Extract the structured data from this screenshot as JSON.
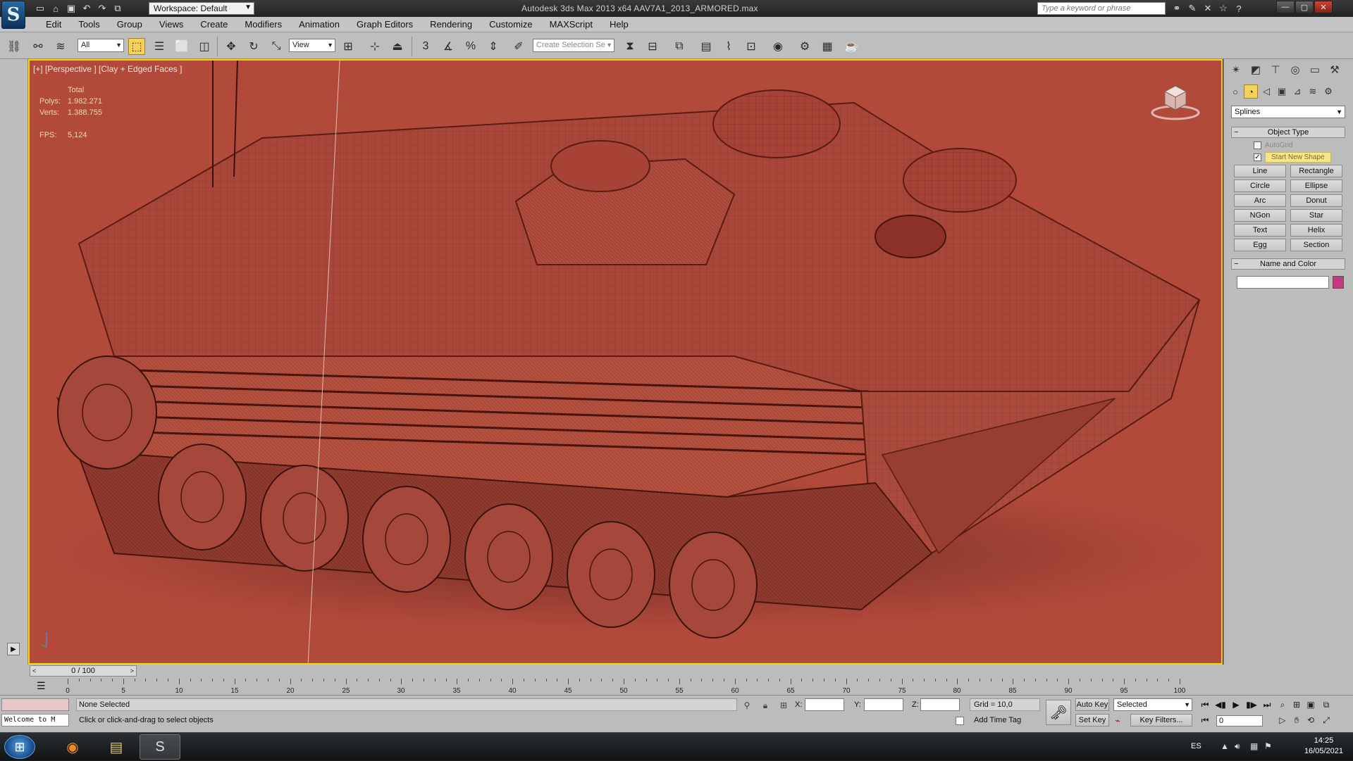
{
  "titlebar": {
    "workspace": "Workspace: Default",
    "window_title": "Autodesk 3ds Max  2013 x64    AAV7A1_2013_ARMORED.max",
    "search_placeholder": "Type a keyword or phrase"
  },
  "menu": [
    "Edit",
    "Tools",
    "Group",
    "Views",
    "Create",
    "Modifiers",
    "Animation",
    "Graph Editors",
    "Rendering",
    "Customize",
    "MAXScript",
    "Help"
  ],
  "toolbar": {
    "filter": "All",
    "ref_coord": "View",
    "selection_set_placeholder": "Create Selection Se"
  },
  "viewport": {
    "label": "[+] [Perspective ] [Clay + Edged Faces ]",
    "stats": {
      "header": "Total",
      "polys_label": "Polys:",
      "polys": "1.982.271",
      "verts_label": "Verts:",
      "verts": "1.388.755",
      "fps_label": "FPS:",
      "fps": "5,124"
    },
    "background": "#b24a3c"
  },
  "command_panel": {
    "category": "Splines",
    "object_type_title": "Object Type",
    "autogrid": "AutoGrid",
    "start_new_shape": "Start New Shape",
    "buttons": [
      "Line",
      "Rectangle",
      "Circle",
      "Ellipse",
      "Arc",
      "Donut",
      "NGon",
      "Star",
      "Text",
      "Helix",
      "Egg",
      "Section"
    ],
    "name_color_title": "Name and Color",
    "object_color": "#c8377f"
  },
  "timeline": {
    "slider": "0 / 100",
    "ticks": [
      "0",
      "5",
      "10",
      "15",
      "20",
      "25",
      "30",
      "35",
      "40",
      "45",
      "50",
      "55",
      "60",
      "65",
      "70",
      "75",
      "80",
      "85",
      "90",
      "95",
      "100"
    ]
  },
  "status": {
    "welcome": "Welcome to M",
    "selection": "None Selected",
    "prompt": "Click or click-and-drag to select objects",
    "x_label": "X:",
    "y_label": "Y:",
    "z_label": "Z:",
    "grid": "Grid = 10,0",
    "add_time_tag": "Add Time Tag",
    "auto_key": "Auto Key",
    "set_key": "Set Key",
    "selected": "Selected",
    "key_filters": "Key Filters...",
    "frame": "0"
  },
  "taskbar": {
    "lang": "ES",
    "time": "14:25",
    "date": "16/05/2021"
  }
}
